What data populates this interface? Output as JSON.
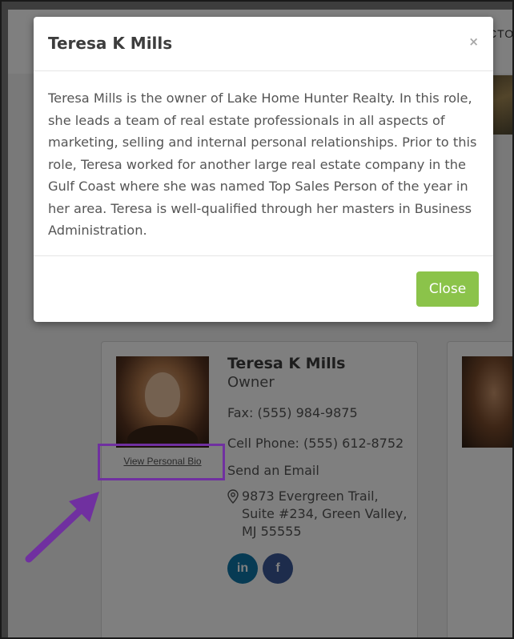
{
  "page": {
    "nav_text": "CTO"
  },
  "modal": {
    "title": "Teresa K Mills",
    "close_icon": "×",
    "bio": "Teresa Mills is the owner of Lake Home Hunter Realty. In this role, she leads a team of real estate professionals in all aspects of marketing, selling and internal personal relationships. Prior to this role, Teresa worked for another large real estate company in the Gulf Coast where she was named Top Sales Person of the year in her area. Teresa is well-qualified through her masters in Business Administration.",
    "close_button_label": "Close",
    "close_button_color": "#8bc34a"
  },
  "agent_card": {
    "name": "Teresa K Mills",
    "title": "Owner",
    "fax": "Fax: (555) 984-9875",
    "cell": "Cell Phone: (555) 612-8752",
    "email_link": "Send an Email",
    "address": "9873 Evergreen Trail, Suite #234, Green Valley, MJ 55555",
    "bio_link": "View Personal Bio",
    "social": {
      "linkedin": "in",
      "facebook": "f"
    }
  },
  "annotation": {
    "highlight_color": "#7030a0"
  }
}
